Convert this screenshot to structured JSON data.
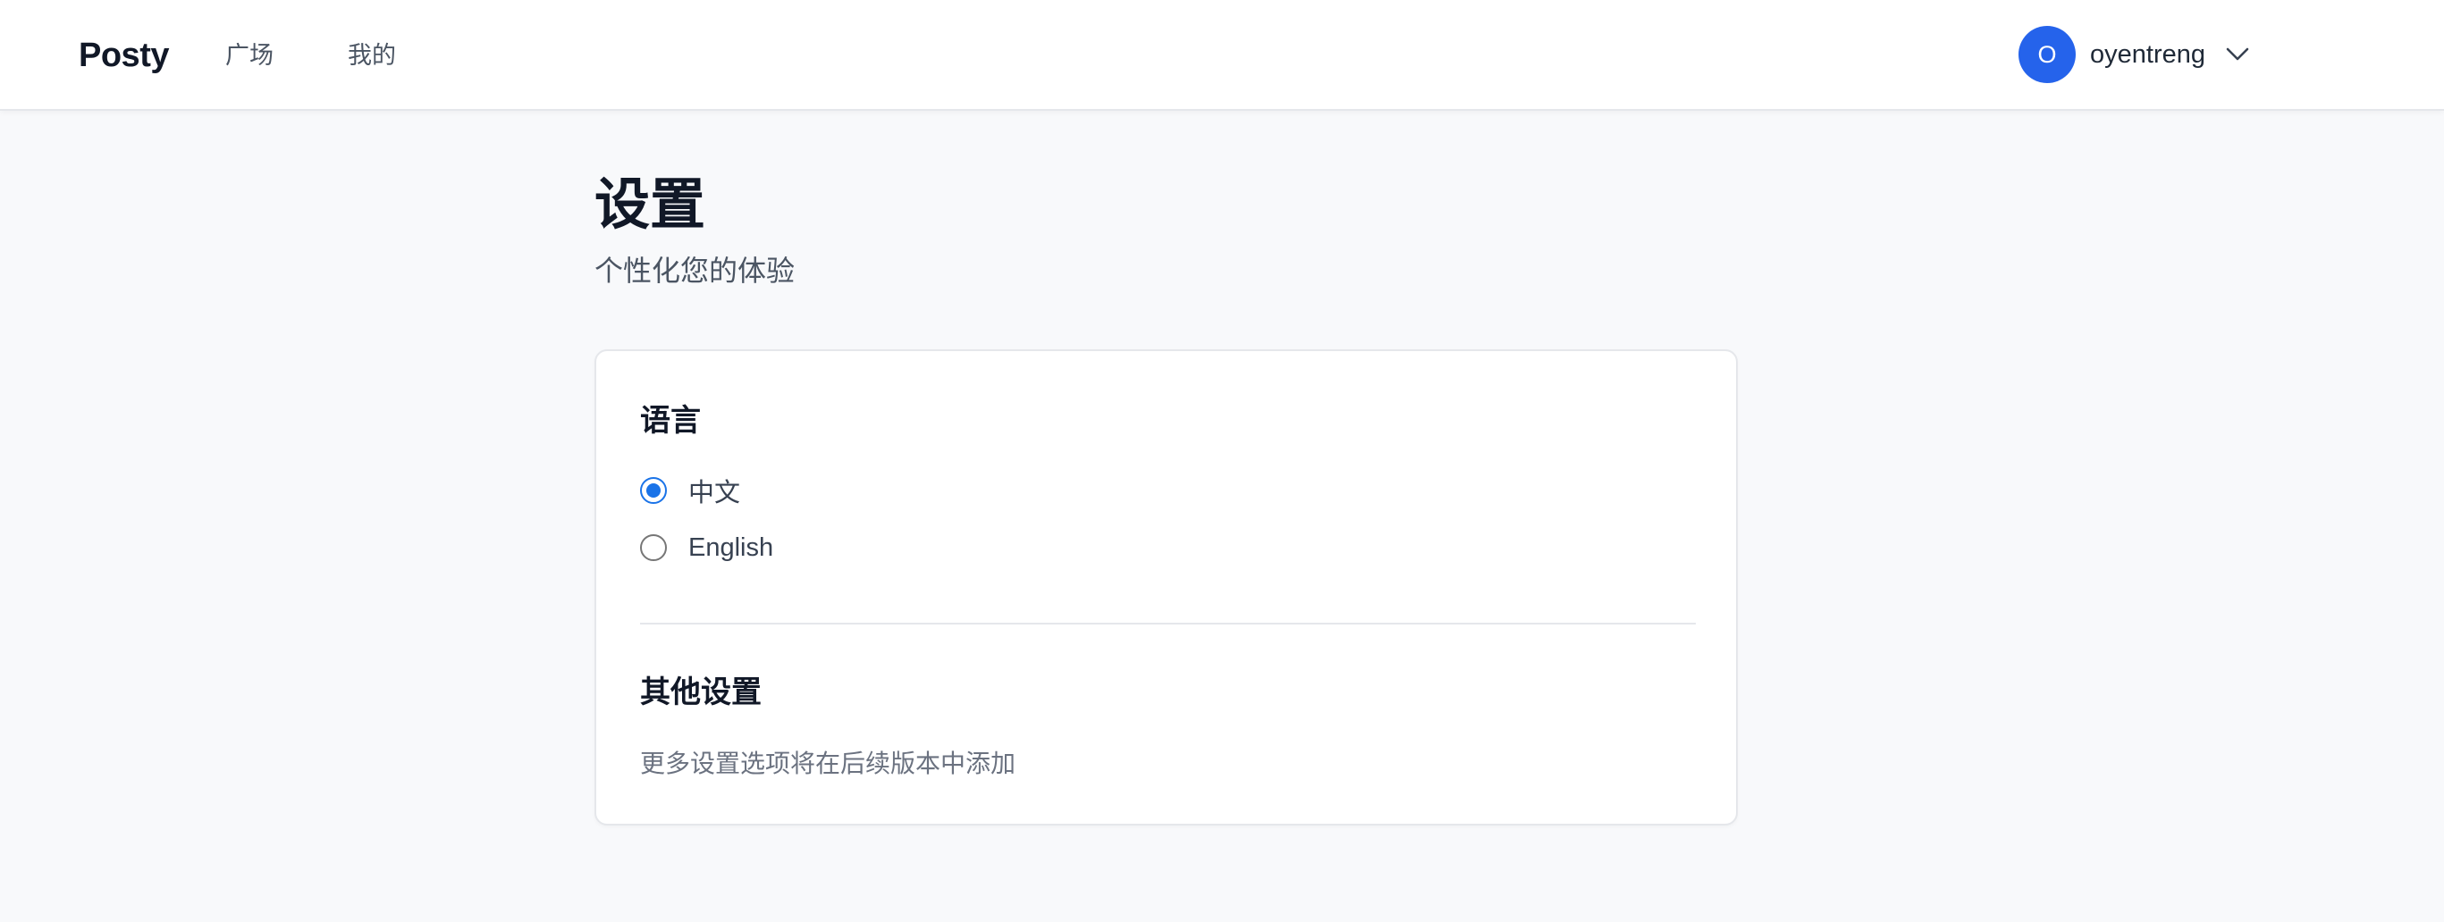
{
  "nav": {
    "brand": "Posty",
    "links": [
      {
        "label": "广场"
      },
      {
        "label": "我的"
      }
    ],
    "user": {
      "avatar_initial": "O",
      "name": "oyentreng",
      "avatar_color": "#2563eb",
      "dropdown_icon": "chevron-down-icon"
    }
  },
  "page": {
    "title": "设置",
    "subtitle": "个性化您的体验"
  },
  "settings": {
    "language": {
      "title": "语言",
      "options": [
        {
          "label": "中文",
          "selected": true
        },
        {
          "label": "English",
          "selected": false
        }
      ]
    },
    "other": {
      "title": "其他设置",
      "description": "更多设置选项将在后续版本中添加"
    }
  },
  "colors": {
    "accent": "#1a73e8",
    "avatar": "#2563eb",
    "background": "#f8f9fb"
  }
}
